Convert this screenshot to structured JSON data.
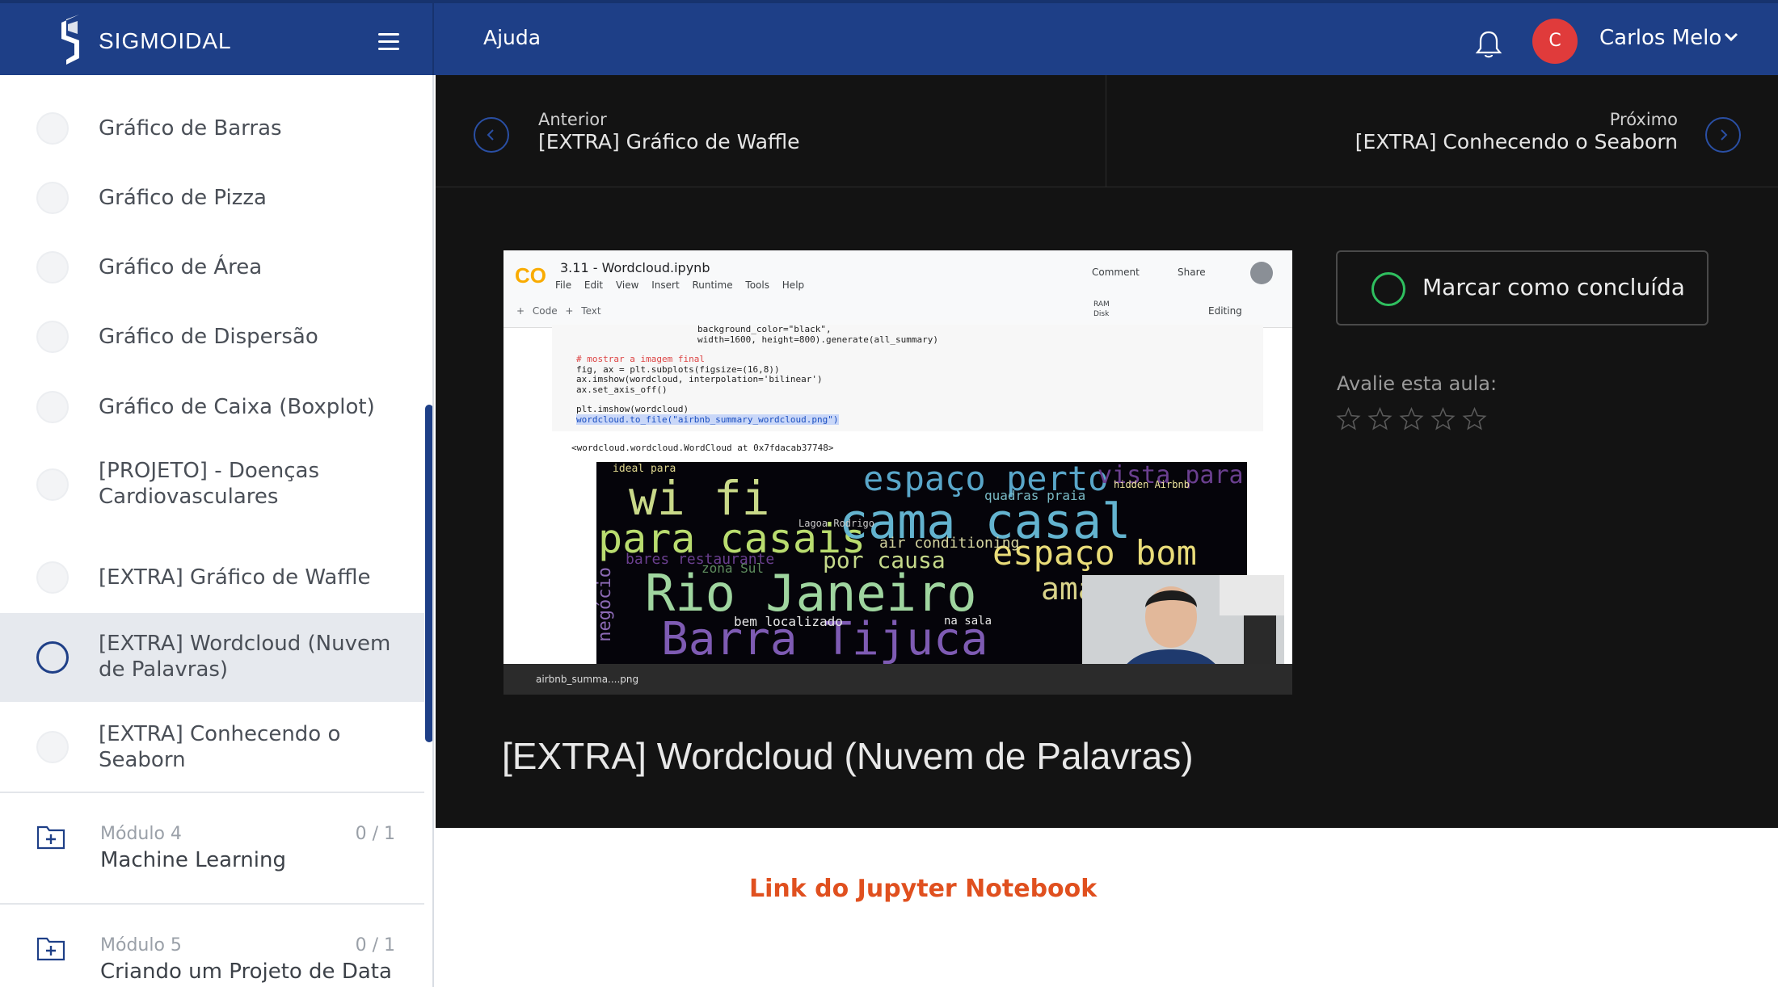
{
  "header": {
    "brand": "SIGMOIDAL",
    "help": "Ajuda",
    "user_initial": "C",
    "user_name": "Carlos Melo"
  },
  "sidebar": {
    "lessons": [
      {
        "label": "Gráfico de Barras",
        "active": false
      },
      {
        "label": "Gráfico de Pizza",
        "active": false
      },
      {
        "label": "Gráfico de Área",
        "active": false
      },
      {
        "label": "Gráfico de Dispersão",
        "active": false
      },
      {
        "label": "Gráfico de Caixa (Boxplot)",
        "active": false
      },
      {
        "label": "[PROJETO] - Doenças Cardiovasculares",
        "active": false
      },
      {
        "label": "[EXTRA] Gráfico de Waffle",
        "active": false
      },
      {
        "label": "[EXTRA] Wordcloud (Nuvem de Palavras)",
        "active": true
      },
      {
        "label": "[EXTRA] Conhecendo o Seaborn",
        "active": false
      }
    ],
    "modules": [
      {
        "number": "Módulo 4",
        "title": "Machine Learning",
        "count": "0 / 1"
      },
      {
        "number": "Módulo 5",
        "title": "Criando um Projeto de Data",
        "count": "0 / 1"
      }
    ]
  },
  "navigation": {
    "prev_label": "Anterior",
    "prev_title": "[EXTRA] Gráfico de Waffle",
    "next_label": "Próximo",
    "next_title": "[EXTRA] Conhecendo o Seaborn"
  },
  "video": {
    "notebook_title": "3.11 - Wordcloud.ipynb",
    "menu": "File Edit View Insert Runtime Tools Help",
    "comment": "Comment",
    "share": "Share",
    "toolbar": "+ Code + Text",
    "ram": "RAM",
    "disk": "Disk",
    "editing": "Editing",
    "code_lines": [
      "background_color=\"black\",",
      "width=1600, height=800).generate(all_summary)",
      "",
      "# mostrar a imagem final",
      "fig, ax = plt.subplots(figsize=(16,8))",
      "ax.imshow(wordcloud, interpolation='bilinear')",
      "ax.set_axis_off()",
      "",
      "plt.imshow(wordcloud)",
      "wordcloud.to_file(\"airbnb_summary_wordcloud.png\")"
    ],
    "output": "<wordcloud.wordcloud.WordCloud at 0x7fdacab37748>",
    "download_file": "airbnb_summa....png",
    "cloud_words": [
      "wi fi",
      "espaço perto",
      "vista para",
      "para casais",
      "cama casal",
      "espaço bom",
      "Rio Janeiro",
      "Barra Tijuca",
      "por causa",
      "bares restaurante",
      "air conditioning",
      "quadras praia",
      "Lagoa Rodrigo",
      "bem localizado",
      "negócio",
      "hidden Airbnb",
      "ideal para",
      "zona Sul",
      "na sala",
      "ama"
    ]
  },
  "lesson": {
    "title": "[EXTRA] Wordcloud (Nuvem de Palavras)",
    "complete_label": "Marcar como concluída",
    "rate_label": "Avalie esta aula:",
    "rating": 0,
    "max_rating": 5,
    "notebook_link": "Link do Jupyter Notebook"
  },
  "colors": {
    "primary": "#1e3f87",
    "accent": "#e0501f",
    "success": "#2fbf5f",
    "avatar": "#e03b3b"
  }
}
